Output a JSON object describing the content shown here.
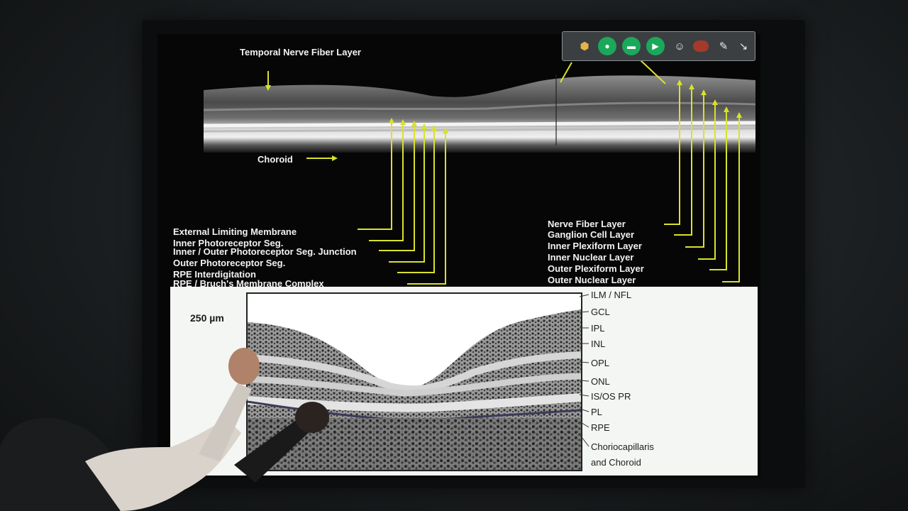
{
  "slide": {
    "top_labels": {
      "temporal_nfl": "Temporal Nerve Fiber Layer",
      "choroid": "Choroid"
    },
    "left_labels": [
      "External Limiting Membrane",
      "Inner Photoreceptor Seg.",
      "Inner / Outer Photoreceptor Seg. Junction",
      "Outer Photoreceptor Seg.",
      "RPE Interdigitation",
      "RPE / Bruch's Membrane Complex"
    ],
    "right_labels": [
      "Nerve Fiber Layer",
      "Ganglion Cell Layer",
      "Inner Plexiform Layer",
      "Inner Nuclear Layer",
      "Outer Plexiform Layer",
      "Outer Nuclear Layer"
    ],
    "histology": {
      "scale": "250 µm",
      "labels": [
        "ILM / NFL",
        "GCL",
        "IPL",
        "INL",
        "OPL",
        "ONL",
        "IS/OS PR",
        "PL",
        "RPE",
        "Choriocapillaris",
        "and Choroid"
      ]
    }
  },
  "toolbar": {
    "icons": [
      "cube-icon",
      "microphone-icon",
      "screen-share-icon",
      "camera-icon",
      "participants-icon",
      "record-icon",
      "pen-icon",
      "pointer-icon"
    ]
  },
  "colors": {
    "annotation_line": "#d8e22a",
    "label_text": "#f2f2f2",
    "toolbar_green": "#1aa85a",
    "record_red": "#a33a2a"
  }
}
